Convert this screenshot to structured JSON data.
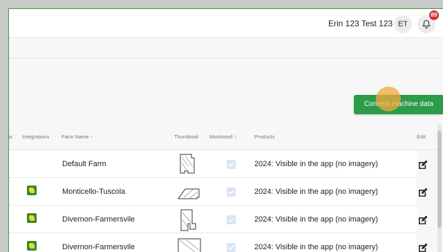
{
  "header": {
    "user_name": "Erin 123 Test 123",
    "avatar_initials": "ET",
    "notification_count": "89"
  },
  "actions": {
    "connect_label": "Connect machine data"
  },
  "table": {
    "columns": [
      "ps",
      "Integrations",
      "Farm Name ↑",
      "Thumbnail",
      "Monitored ↑",
      "Products",
      "Edit"
    ],
    "rows": [
      {
        "farm": "Default Farm",
        "product": "2024: Visible in the app (no imagery)",
        "integration": false,
        "monitored": true
      },
      {
        "farm": "Monticello-Tuscola",
        "product": "2024: Visible in the app (no imagery)",
        "integration": true,
        "monitored": true
      },
      {
        "farm": "Divernon-Farmersvile",
        "product": "2024: Visible in the app (no imagery)",
        "integration": true,
        "monitored": true
      },
      {
        "farm": "Divernon-Farmersvile",
        "product": "2024: Visible in the app (no imagery)",
        "integration": true,
        "monitored": true
      }
    ]
  },
  "colors": {
    "primary_green": "#2c9b4a",
    "badge_red": "#d0303a",
    "border_green": "#3a9b3a"
  }
}
